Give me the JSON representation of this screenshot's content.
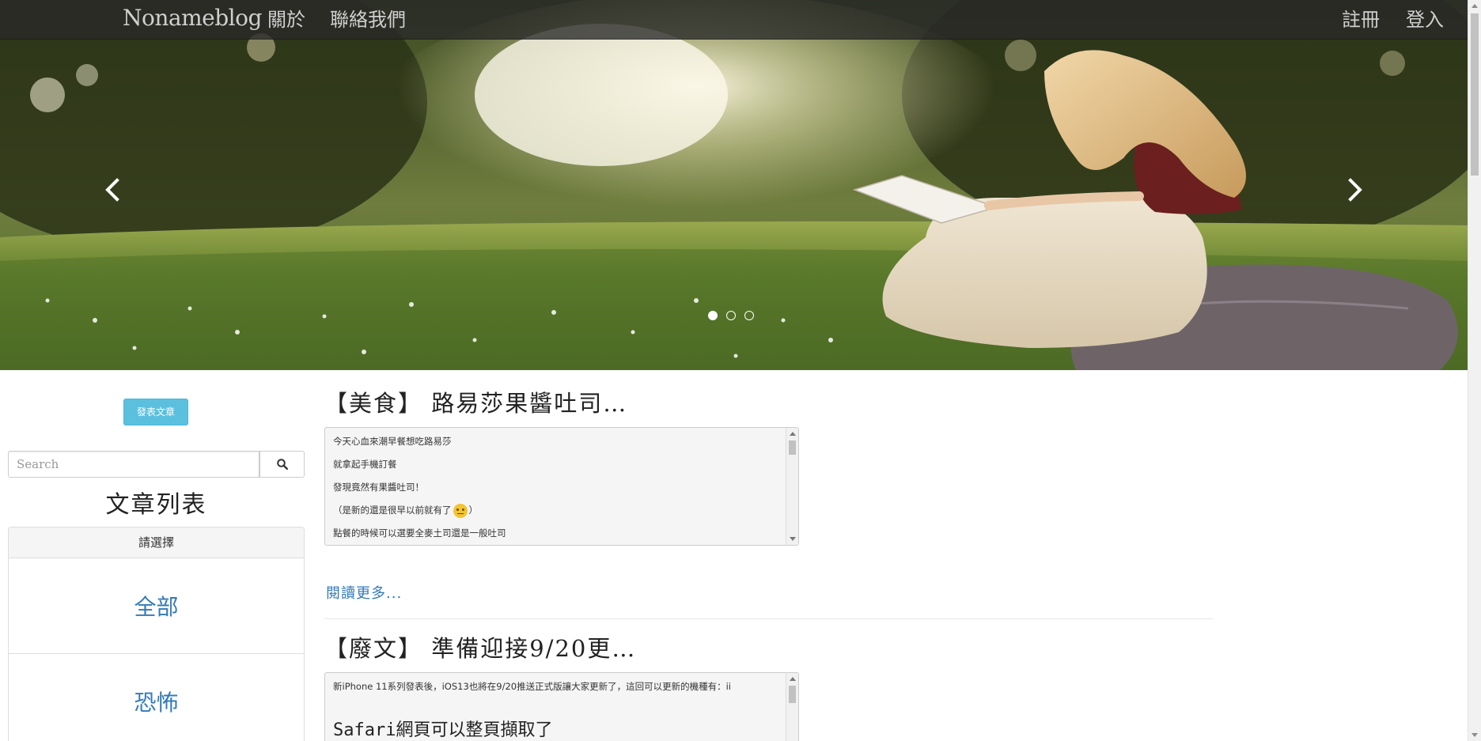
{
  "navbar": {
    "brand": "Nonameblog",
    "about": "關於",
    "contact": "聯絡我們",
    "register": "註冊",
    "login": "登入"
  },
  "carousel": {
    "prev_icon": "chevron-left-icon",
    "next_icon": "chevron-right-icon",
    "slide_count": 3,
    "active_slide": 1
  },
  "sidebar": {
    "post_button": "發表文章",
    "search_placeholder": "Search",
    "search_icon": "search-icon",
    "list_title": "文章列表",
    "panel_heading": "請選擇",
    "categories": [
      "全部",
      "恐怖"
    ]
  },
  "articles": [
    {
      "title": "【美食】 路易莎果醬吐司…",
      "lines": [
        "今天心血來潮早餐想吃路易莎",
        "就拿起手機訂餐",
        "發現竟然有果醬吐司！",
        "（是新的還是很早以前就有了",
        "）",
        "點餐的時候可以選要全麥土司還是一般吐司"
      ],
      "read_more": "閱讀更多..."
    },
    {
      "title": "【廢文】 準備迎接9/20更…",
      "lines": [
        "新iPhone 11系列發表後，iOS13也將在9/20推送正式版讓大家更新了，這回可以更新的機種有：ii",
        "Safari網頁可以整頁擷取了"
      ]
    }
  ],
  "colors": {
    "navbar_bg": "#282828",
    "link": "#337ab7",
    "info_button": "#5bc0de"
  }
}
